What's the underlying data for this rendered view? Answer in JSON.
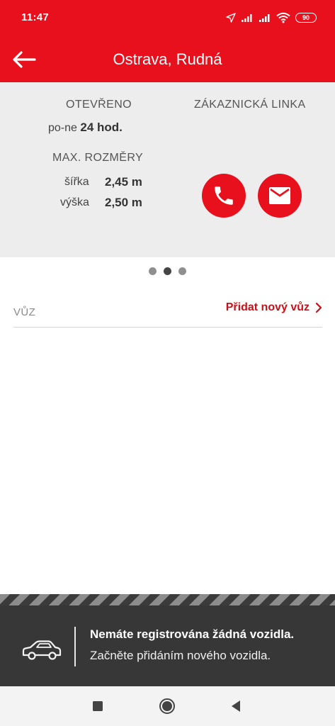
{
  "status_bar": {
    "time": "11:47",
    "battery": "90",
    "icons": [
      "location-arrow-icon",
      "signal-icon",
      "signal-icon",
      "wifi-icon",
      "battery-icon"
    ]
  },
  "header": {
    "title": "Ostrava, Rudná",
    "back_icon": "arrow-left-icon",
    "background": "#e8101c"
  },
  "info": {
    "open_label": "OTEVŘENO",
    "hours_prefix": "po-ne",
    "hours_value": "24 hod.",
    "max_label": "MAX. ROZMĚRY",
    "width_label": "šířka",
    "width_value": "2,45 m",
    "height_label": "výška",
    "height_value": "2,50 m",
    "support_label": "ZÁKAZNICKÁ LINKA",
    "call_icon": "phone-icon",
    "mail_icon": "mail-icon"
  },
  "pager": {
    "count": 3,
    "active": 2
  },
  "car": {
    "label": "VŮZ",
    "add_label": "Přidat nový vůz"
  },
  "banner": {
    "title": "Nemáte registrována žádná vozidla.",
    "subtitle": "Začněte přidáním nového vozidla.",
    "icon": "car-icon"
  },
  "nav": {
    "icons": [
      "square-recents-icon",
      "circle-home-icon",
      "triangle-back-icon"
    ]
  },
  "colors": {
    "accent": "#e8101c",
    "link": "#c8101a",
    "panel": "#ededed",
    "banner": "#3b3b3b"
  }
}
